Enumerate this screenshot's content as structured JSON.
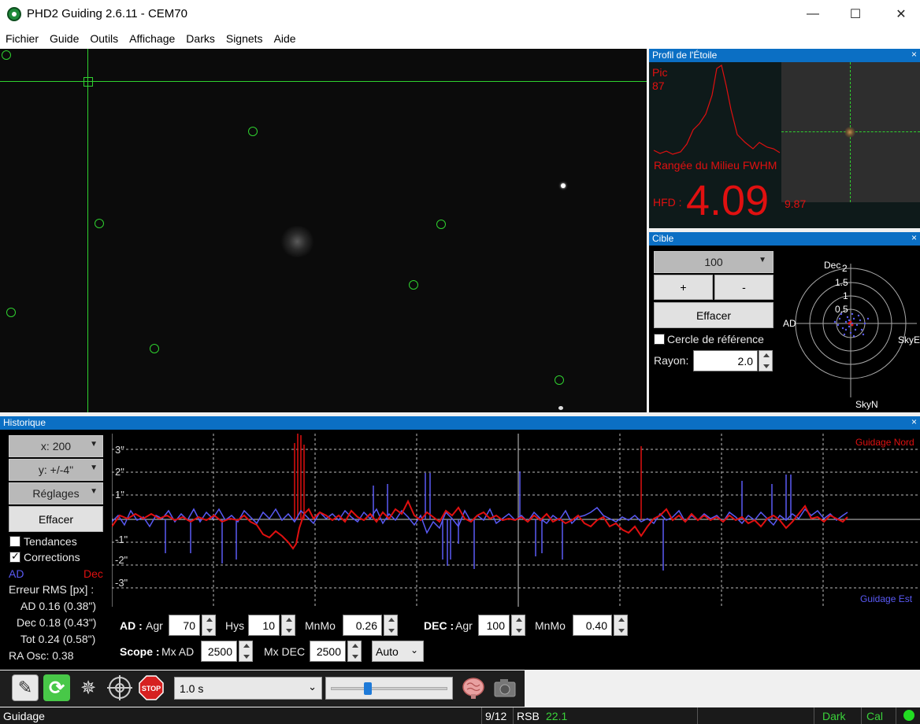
{
  "window": {
    "title": "PHD2 Guiding 2.6.11 - CEM70",
    "minimize": "—",
    "maximize": "☐",
    "close": "✕"
  },
  "menu": [
    "Fichier",
    "Guide",
    "Outils",
    "Affichage",
    "Darks",
    "Signets",
    "Aide"
  ],
  "profile": {
    "title": "Profil de l'Étoile",
    "close": "×",
    "peak_label": "Pic",
    "peak_value": "87",
    "mid_row_label": "Rangée du Milieu FWHM",
    "hfd_label": "HFD :",
    "hfd_value": "4.09",
    "fwhm_value": "9.87"
  },
  "target": {
    "title": "Cible",
    "close": "×",
    "length_select": "100",
    "zoom_in": "+",
    "zoom_out": "-",
    "clear": "Effacer",
    "ref_circle_label": "Cercle de référence",
    "ref_circle_checked": false,
    "radius_label": "Rayon:",
    "radius_value": "2.0",
    "labels": {
      "dec": "Dec",
      "ad": "AD",
      "skye": "SkyE",
      "skyn": "SkyN"
    },
    "ring_labels": [
      "2",
      "1.5",
      "1",
      "0.5"
    ]
  },
  "history": {
    "title": "Historique",
    "close": "×",
    "x_select": "x: 200",
    "y_select": "y: +/-4\"",
    "settings_select": "Réglages",
    "clear": "Effacer",
    "trends_label": "Tendances",
    "trends_checked": false,
    "corrections_label": "Corrections",
    "corrections_checked": true,
    "ra_legend": "AD",
    "dec_legend": "Dec",
    "rms_title": "Erreur RMS [px] :",
    "rms_ra": "AD 0.16 (0.38\")",
    "rms_dec": "Dec 0.18 (0.43\")",
    "rms_tot": "Tot 0.24 (0.58\")",
    "ra_osc": "RA Osc: 0.38",
    "guide_north": "Guidage Nord",
    "guide_east": "Guidage Est",
    "y_ticks": [
      "3\"",
      "2\"",
      "1\"",
      "-1\"",
      "-2\"",
      "-3\""
    ],
    "colors": {
      "ra": "#5a5af5",
      "dec": "#e01010"
    }
  },
  "ra_params": {
    "label": "AD :",
    "agr_label": "Agr",
    "agr_value": "70",
    "hys_label": "Hys",
    "hys_value": "10",
    "mnmo_label": "MnMo",
    "mnmo_value": "0.26"
  },
  "dec_params": {
    "label": "DEC :",
    "agr_label": "Agr",
    "agr_value": "100",
    "mnmo_label": "MnMo",
    "mnmo_value": "0.40"
  },
  "scope_params": {
    "label": "Scope :",
    "mx_ra_label": "Mx AD",
    "mx_ra_value": "2500",
    "mx_dec_label": "Mx DEC",
    "mx_dec_value": "2500",
    "mode_select": "Auto"
  },
  "toolbar": {
    "exposure_select": "1.0 s",
    "gamma_level": 0.32,
    "stop_label": "STOP"
  },
  "status": {
    "state": "Guidage",
    "frames": "9/12",
    "snr_label": "RSB",
    "snr_value": "22.1",
    "dark": "Dark",
    "cal": "Cal"
  }
}
